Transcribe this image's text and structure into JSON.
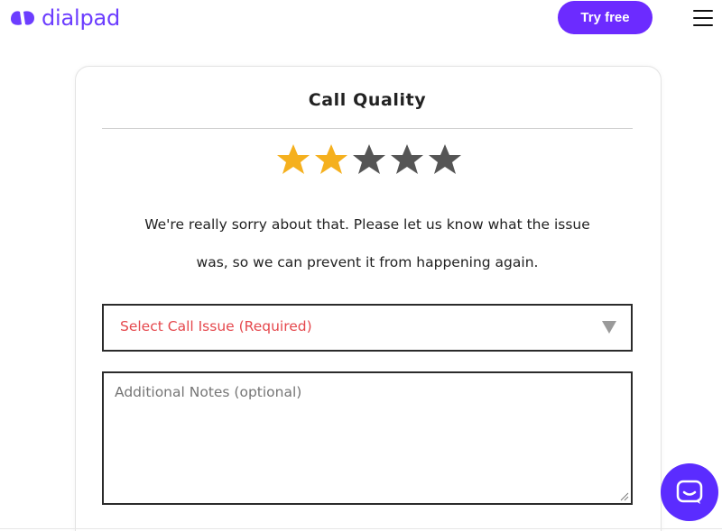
{
  "header": {
    "brand": "dialpad",
    "try_free_label": "Try free",
    "menu_icon": "hamburger-menu-icon"
  },
  "card": {
    "title": "Call Quality",
    "rating": {
      "value": 2,
      "max": 5,
      "filled_color": "#f5b01e",
      "empty_color": "#555555"
    },
    "message_line1": "We're really sorry about that. Please let us know what the issue",
    "message_line2": "was, so we can prevent it from happening again.",
    "issue_select": {
      "selected_label": "Select Call Issue (Required)",
      "arrow_icon": "triangle-down-icon"
    },
    "notes": {
      "placeholder": "Additional Notes (optional)"
    }
  },
  "chat_widget": {
    "icon": "chat-bubble-icon"
  },
  "colors": {
    "brand": "#6c2bff",
    "required_text": "#e5484d"
  }
}
